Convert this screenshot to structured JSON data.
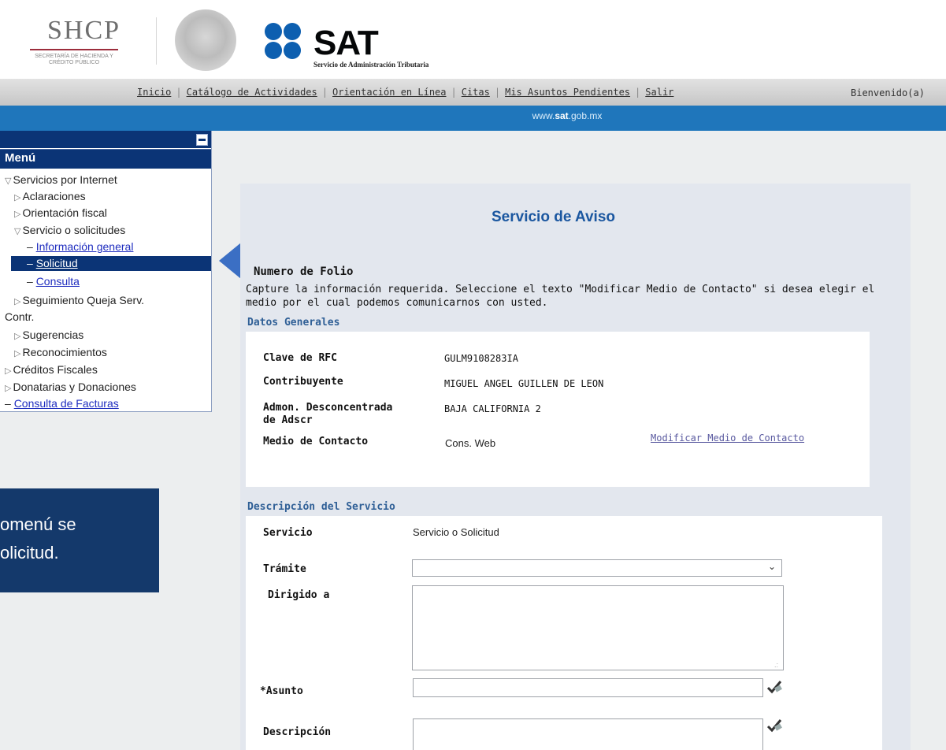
{
  "header": {
    "shcp": {
      "title": "SHCP",
      "subtitle": "SECRETARÍA DE HACIENDA Y CRÉDITO PÚBLICO"
    },
    "sat": {
      "title": "SAT",
      "subtitle": "Servicio de Administración Tributaria"
    }
  },
  "nav": {
    "links": [
      "Inicio",
      "Catálogo de Actividades",
      "Orientación en Línea",
      "Citas",
      "Mis Asuntos Pendientes",
      "Salir"
    ],
    "welcome": "Bienvenido(a)"
  },
  "site": {
    "url_prefix": "www.",
    "url_bold": "sat",
    "url_suffix": ".gob.mx"
  },
  "sidebar": {
    "menu_title": "Menú",
    "items": [
      {
        "label": "Servicios por Internet"
      },
      {
        "label": "Aclaraciones"
      },
      {
        "label": "Orientación fiscal"
      },
      {
        "label": "Servicio o solicitudes"
      },
      {
        "label": "Información general"
      },
      {
        "label": "Solicitud"
      },
      {
        "label": "Consulta"
      },
      {
        "label": "Seguimiento Queja Serv."
      },
      {
        "label": "Contr."
      },
      {
        "label": "Sugerencias"
      },
      {
        "label": "Reconocimientos"
      },
      {
        "label": "Créditos Fiscales"
      },
      {
        "label": "Donatarias y Donaciones"
      },
      {
        "label": "Consulta de Facturas"
      }
    ]
  },
  "callout": {
    "line1": "omenú se",
    "line2": "olicitud."
  },
  "form": {
    "title": "Servicio de Aviso",
    "folio_label": "Numero de Folio",
    "instructions": "Capture la información requerida. Seleccione el texto \"Modificar Medio de Contacto\" si desea elegir el medio por el cual podemos comunicarnos con usted.",
    "datos_generales": {
      "heading": "Datos Generales",
      "rfc_label": "Clave de RFC",
      "rfc_value": "GULM9108283IA",
      "contribuyente_label": "Contribuyente",
      "contribuyente_value": "MIGUEL ANGEL GUILLEN DE LEON",
      "admon_label_1": "Admon. Desconcentrada",
      "admon_label_2": "de Adscr",
      "admon_value": "BAJA CALIFORNIA 2",
      "medio_label": "Medio de Contacto",
      "medio_value": "Cons. Web",
      "modificar_link": "Modificar Medio de Contacto"
    },
    "descripcion_servicio": {
      "heading": "Descripción del Servicio",
      "servicio_label": "Servicio",
      "servicio_value": "Servicio o Solicitud",
      "tramite_label": "Trámite",
      "tramite_value": "",
      "dirigido_label": "Dirigido a",
      "dirigido_value": "",
      "asunto_label": "*Asunto",
      "asunto_value": "",
      "descripcion_label": "Descripción",
      "descripcion_value": ""
    }
  },
  "colors": {
    "sat_blue": "#1f76bb",
    "menu_navy": "#0b3476",
    "callout_navy": "#14396b",
    "heading_blue": "#2f5f96",
    "arrow_blue": "#3b6fc4"
  }
}
